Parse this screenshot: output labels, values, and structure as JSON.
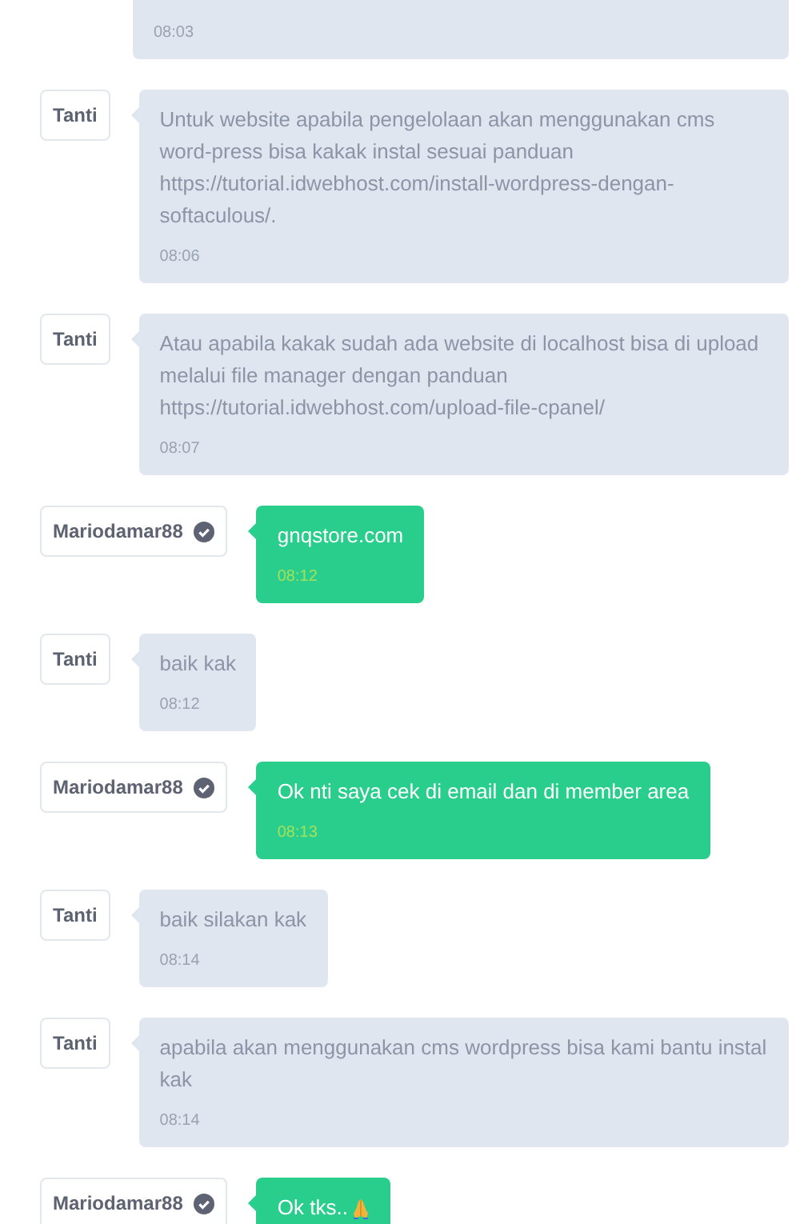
{
  "messages": [
    {
      "kind": "agent",
      "time": "08:03"
    },
    {
      "kind": "agent",
      "sender": "Tanti",
      "text": "Untuk website apabila pengelolaan akan menggunakan cms word-press bisa kakak instal sesuai panduan https://tutorial.idwebhost.com/install-wordpress-dengan-softaculous/.",
      "time": "08:06"
    },
    {
      "kind": "agent",
      "sender": "Tanti",
      "text": "Atau apabila kakak sudah ada website di localhost bisa di upload melalui file manager dengan panduan https://tutorial.idwebhost.com/upload-file-cpanel/",
      "time": "08:07"
    },
    {
      "kind": "customer",
      "sender": "Mariodamar88",
      "text": "gnqstore.com",
      "time": "08:12"
    },
    {
      "kind": "agent",
      "sender": "Tanti",
      "text": "baik kak",
      "time": "08:12"
    },
    {
      "kind": "customer",
      "sender": "Mariodamar88",
      "text": "Ok nti saya cek di email dan di member area",
      "time": "08:13"
    },
    {
      "kind": "agent",
      "sender": "Tanti",
      "text": "baik silakan kak",
      "time": "08:14"
    },
    {
      "kind": "agent",
      "sender": "Tanti",
      "text": "apabila akan menggunakan cms wordpress bisa kami bantu instal kak",
      "time": "08:14"
    },
    {
      "kind": "customer",
      "sender": "Mariodamar88",
      "text": "Ok tks..",
      "emoji": true
    }
  ]
}
